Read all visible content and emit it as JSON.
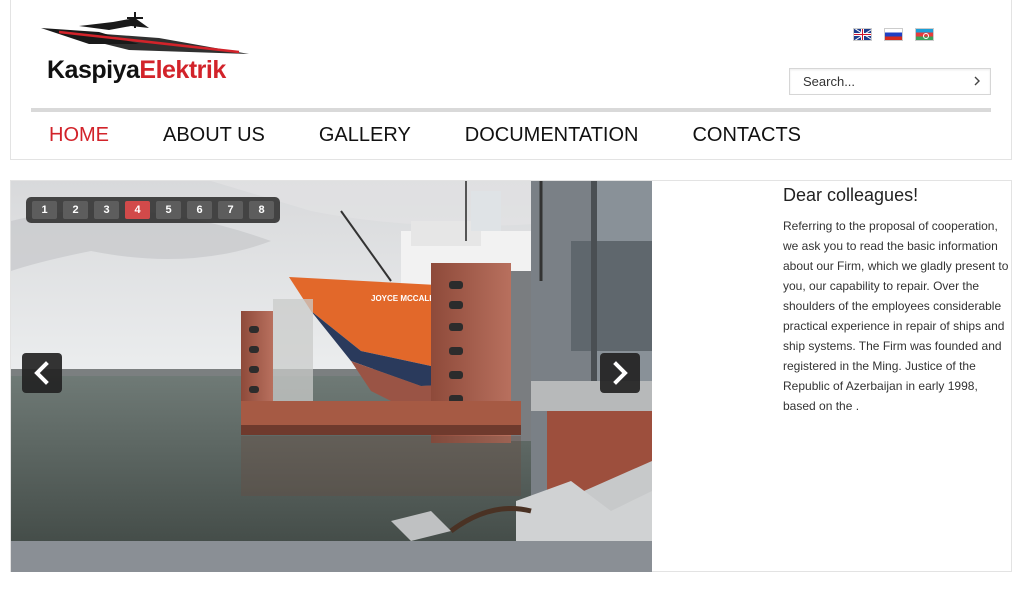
{
  "brand": {
    "logo_part1": "Kaspiya",
    "logo_part2": "Elektrik"
  },
  "languages": [
    {
      "icon": "uk-flag-icon"
    },
    {
      "icon": "russia-flag-icon"
    },
    {
      "icon": "azerbaijan-flag-icon"
    }
  ],
  "search": {
    "placeholder": "Search...",
    "button_icon": "chevron-right-icon"
  },
  "nav": {
    "items": [
      "HOME",
      "ABOUT US",
      "GALLERY",
      "DOCUMENTATION",
      "CONTACTS"
    ],
    "active_index": 0
  },
  "slider": {
    "pages": [
      "1",
      "2",
      "3",
      "4",
      "5",
      "6",
      "7",
      "8"
    ],
    "active_page": "4",
    "ship_name": "JOYCE MCCALL",
    "prev_icon": "chevron-left-icon",
    "next_icon": "chevron-right-icon"
  },
  "welcome": {
    "title": "Dear colleagues!",
    "body": "Referring to the proposal of cooperation, we ask you to read the basic information about our Firm, which we gladly present to you, our capability to repair. Over the shoulders of the employees considerable practical experience in repair of ships and ship systems. The Firm was founded and registered in the Ming. Justice of the Republic of Azerbaijan in early 1998, based on the ."
  },
  "colors": {
    "accent": "#d2232a",
    "text": "#111111",
    "pager_active": "#d24a4a"
  }
}
